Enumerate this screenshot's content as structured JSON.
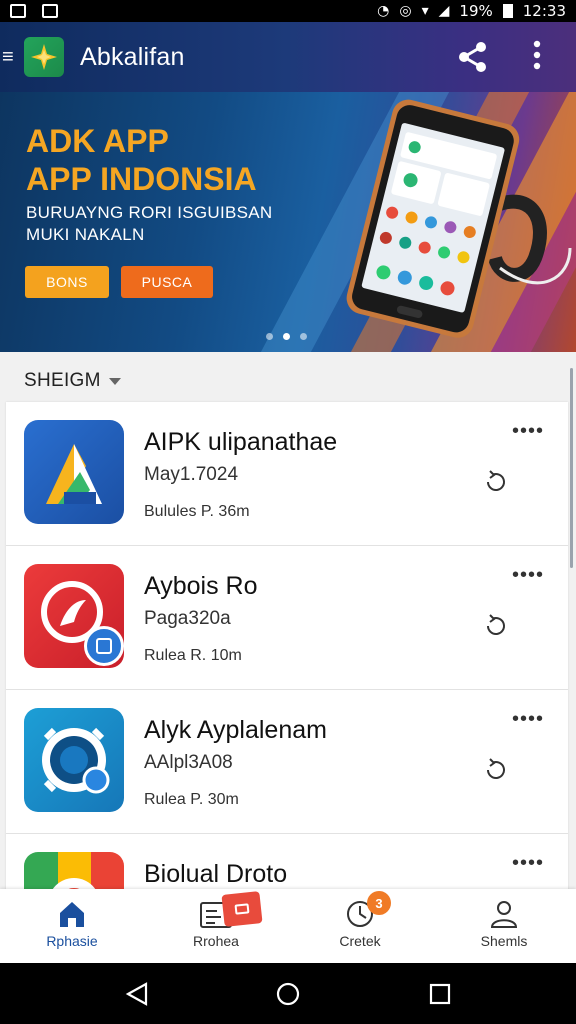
{
  "status_bar": {
    "battery": "19%",
    "time": "12:33"
  },
  "app_bar": {
    "title": "Abkalifan",
    "menu_icon": "hamburger-icon",
    "logo_icon": "star-logo-icon",
    "share_icon": "share-icon",
    "more_icon": "more-vert-icon"
  },
  "banner": {
    "headline_line1": "ADK APP",
    "headline_line2": "APP INDONSIA",
    "subtitle_line1": "BURUAYNG RORI ISGUIBSAN",
    "subtitle_line2": "MUKI NAKALN",
    "button1_label": "BONS",
    "button2_label": "PUSCA",
    "slide_count": 3,
    "active_slide": 1,
    "colors": {
      "headline": "#f5a623",
      "button1": "#f4a21e",
      "button2": "#ee6b1c"
    }
  },
  "section": {
    "title": "SHEIGM"
  },
  "apps": [
    {
      "name": "AIPK ulipanathae",
      "date": "May1.7024",
      "size": "Bulules P. 36m",
      "icon": "app-logo-blue-icon"
    },
    {
      "name": "Aybois Ro",
      "date": "Paga320a",
      "size": "Rulea R. 10m",
      "icon": "app-logo-red-icon"
    },
    {
      "name": "Alyk Ayplalenam",
      "date": "AAlpl3A08",
      "size": "Rulea P. 30m",
      "icon": "app-logo-camera-icon"
    },
    {
      "name": "Biolual Droto",
      "date": "",
      "size": "",
      "icon": "app-logo-chrome-icon"
    }
  ],
  "bottom_nav": [
    {
      "label": "Rphasie",
      "icon": "home-icon",
      "active": true
    },
    {
      "label": "Rrohea",
      "icon": "apps-icon",
      "active": false
    },
    {
      "label": "Cretek",
      "icon": "update-icon",
      "active": false,
      "badge": "3"
    },
    {
      "label": "Shemls",
      "icon": "profile-icon",
      "active": false
    }
  ],
  "system_nav": {
    "back_icon": "back-icon",
    "home_icon": "home-circle-icon",
    "recents_icon": "recents-icon"
  }
}
